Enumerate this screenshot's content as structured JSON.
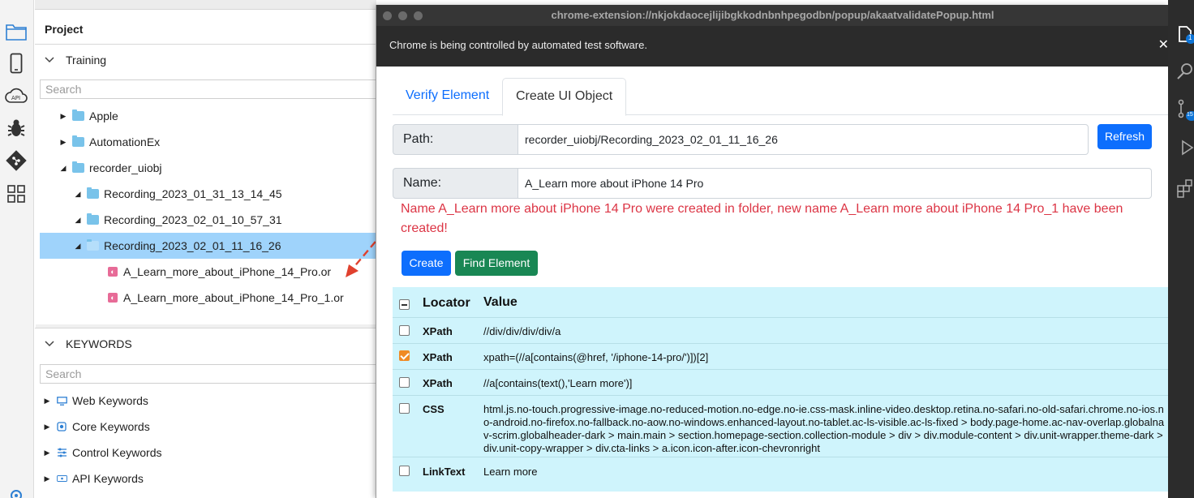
{
  "project": {
    "title": "Project",
    "training_label": "Training",
    "search_placeholder": "Search",
    "tree": [
      {
        "label": "Apple"
      },
      {
        "label": "AutomationEx"
      },
      {
        "label": "recorder_uiobj"
      },
      {
        "label": "Recording_2023_01_31_13_14_45"
      },
      {
        "label": "Recording_2023_02_01_10_57_31"
      },
      {
        "label": "Recording_2023_02_01_11_16_26"
      },
      {
        "label": "A_Learn_more_about_iPhone_14_Pro.or"
      },
      {
        "label": "A_Learn_more_about_iPhone_14_Pro_1.or"
      }
    ]
  },
  "keywords": {
    "title": "KEYWORDS",
    "search_placeholder": "Search",
    "items": [
      {
        "label": "Web Keywords"
      },
      {
        "label": "Core Keywords"
      },
      {
        "label": "Control Keywords"
      },
      {
        "label": "API Keywords"
      }
    ]
  },
  "activity": {
    "api_label": "API"
  },
  "popup": {
    "window_title": "chrome-extension://nkjokdaocejlijibgkkodnbnhpegodbn/popup/akaatvalidatePopup.html",
    "infobar": "Chrome is being controlled by automated test software.",
    "close_glyph": "✕",
    "tabs": [
      {
        "label": "Verify Element"
      },
      {
        "label": "Create UI Object"
      }
    ],
    "path_label": "Path:",
    "path_value": "recorder_uiobj/Recording_2023_02_01_11_16_26",
    "refresh_label": "Refresh",
    "name_label": "Name:",
    "name_value": "A_Learn more about iPhone 14 Pro",
    "message": "Name A_Learn more about iPhone 14 Pro were created in folder, new name A_Learn more about iPhone 14 Pro_1 have been created!",
    "create_label": "Create",
    "find_label": "Find Element",
    "table": {
      "header_locator": "Locator",
      "header_value": "Value",
      "rows": [
        {
          "locator": "XPath",
          "value": "//div/div/div/div/a",
          "checked": false
        },
        {
          "locator": "XPath",
          "value": "xpath=(//a[contains(@href, '/iphone-14-pro/')])[2]",
          "checked": true
        },
        {
          "locator": "XPath",
          "value": "//a[contains(text(),'Learn more')]",
          "checked": false
        },
        {
          "locator": "CSS",
          "value": "html.js.no-touch.progressive-image.no-reduced-motion.no-edge.no-ie.css-mask.inline-video.desktop.retina.no-safari.no-old-safari.chrome.no-ios.no-android.no-firefox.no-fallback.no-aow.no-windows.enhanced-layout.no-tablet.ac-ls-visible.ac-ls-fixed > body.page-home.ac-nav-overlap.globalnav-scrim.globalheader-dark > main.main > section.homepage-section.collection-module > div > div.module-content > div.unit-wrapper.theme-dark > div.unit-copy-wrapper > div.cta-links > a.icon.icon-after.icon-chevronright",
          "checked": false
        },
        {
          "locator": "LinkText",
          "value": "Learn more",
          "checked": false
        }
      ]
    }
  },
  "vscode": {
    "badge_1": "1",
    "badge_2": "15"
  },
  "colors": {
    "accent_blue": "#0d6efd",
    "success_green": "#198754",
    "danger_red": "#dc3545",
    "table_bg": "#cff4fc",
    "selection": "#9fd3fb"
  }
}
